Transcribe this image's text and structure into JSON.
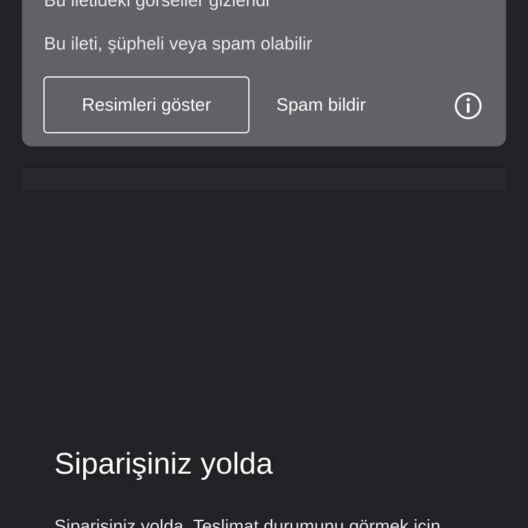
{
  "warning": {
    "title": "Bu iletideki görseller gizlendi",
    "subtitle": "Bu ileti, şüpheli veya spam olabilir",
    "show_images_label": "Resimleri göster",
    "report_spam_label": "Spam bildir",
    "info_icon": "info-icon"
  },
  "email": {
    "heading": "Siparişiniz yolda",
    "body_preview": "Siparişiniz yolda. Teslimat durumunu görmek için"
  },
  "colors": {
    "background": "#202124",
    "card": "#5f6368",
    "text": "#e8eaed"
  }
}
